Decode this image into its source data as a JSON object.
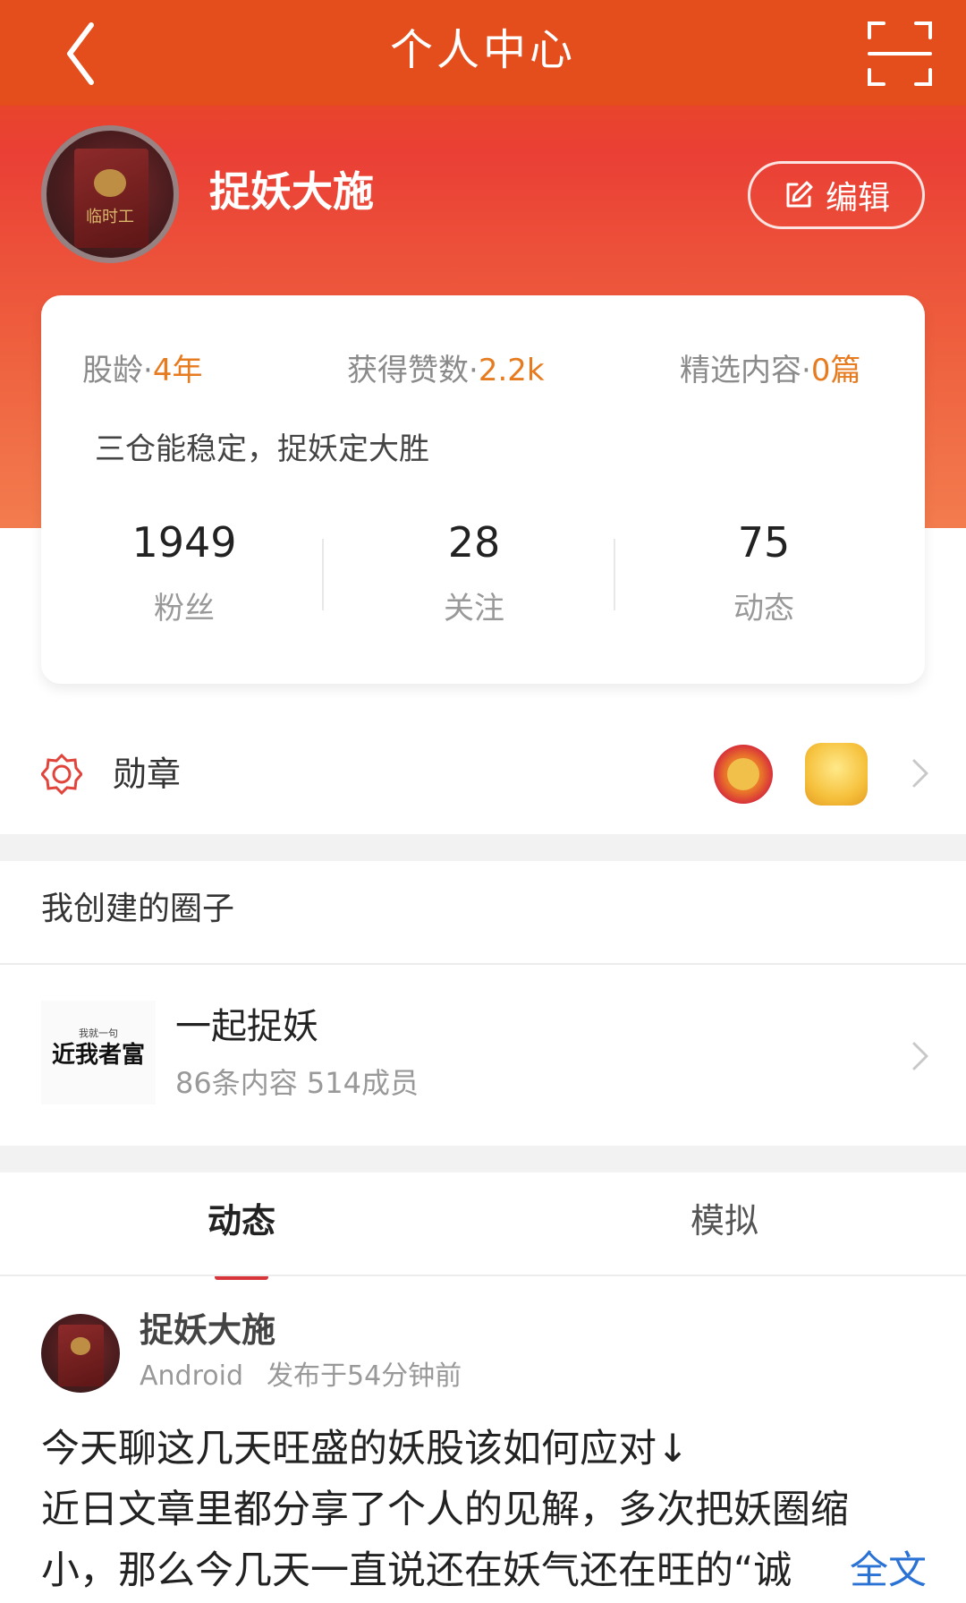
{
  "header": {
    "title": "个人中心",
    "back_icon": "chevron-left-icon",
    "scan_icon": "scan-icon"
  },
  "profile": {
    "username": "捉妖大施",
    "edit_label": "编辑",
    "avatar_caption": "临时工",
    "stats": [
      {
        "label": "股龄·",
        "value": "4年"
      },
      {
        "label": "获得赞数·",
        "value": "2.2k"
      },
      {
        "label": "精选内容·",
        "value": "0篇"
      }
    ],
    "motto": "三仓能稳定，捉妖定大胜",
    "counts": [
      {
        "number": "1949",
        "label": "粉丝"
      },
      {
        "number": "28",
        "label": "关注"
      },
      {
        "number": "75",
        "label": "动态"
      }
    ]
  },
  "medals": {
    "label": "勋章",
    "icon": "medal-icon"
  },
  "circles": {
    "section_title": "我创建的圈子",
    "items": [
      {
        "thumb_small": "我就一句",
        "thumb_big": "近我者富",
        "name": "一起捉妖",
        "meta": "86条内容 514成员"
      }
    ]
  },
  "tabs": [
    {
      "label": "动态",
      "active": true
    },
    {
      "label": "模拟",
      "active": false
    }
  ],
  "post": {
    "author": "捉妖大施",
    "device": "Android",
    "time": "发布于54分钟前",
    "lines": [
      "今天聊这几天旺盛的妖股该如何应对↓",
      "近日文章里都分享了个人的见解，多次把妖圈缩",
      "小，那么今几天一直说还在妖气还在旺的“诚"
    ],
    "more_label": "全文"
  },
  "colors": {
    "header": "#e44d1c",
    "accent_orange": "#e77b1f",
    "tab_underline": "#d8353b",
    "link": "#2a72d4"
  }
}
